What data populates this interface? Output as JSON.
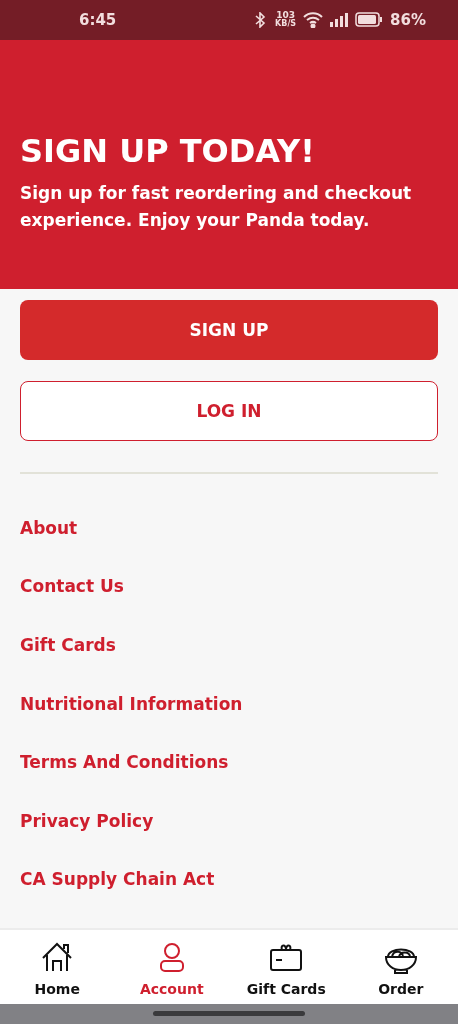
{
  "status_bar": {
    "time": "6:45",
    "speed": "103",
    "speed_unit": "KB/S",
    "battery": "86%"
  },
  "hero": {
    "title": "SIGN UP TODAY!",
    "text": "Sign up for fast reordering and checkout experience. Enjoy your Panda today."
  },
  "buttons": [
    {
      "label": "SIGN UP",
      "kind": "primary"
    },
    {
      "label": "LOG IN",
      "kind": "outline"
    }
  ],
  "links": [
    "About",
    "Contact Us",
    "Gift Cards",
    "Nutritional Information",
    "Terms And Conditions",
    "Privacy Policy",
    "CA Supply Chain Act"
  ],
  "nav": [
    {
      "label": "Home",
      "kind": "home",
      "selected": false
    },
    {
      "label": "Account",
      "kind": "account",
      "selected": true
    },
    {
      "label": "Gift Cards",
      "kind": "giftcard",
      "selected": false
    },
    {
      "label": "Order",
      "kind": "bowl",
      "selected": false
    }
  ]
}
